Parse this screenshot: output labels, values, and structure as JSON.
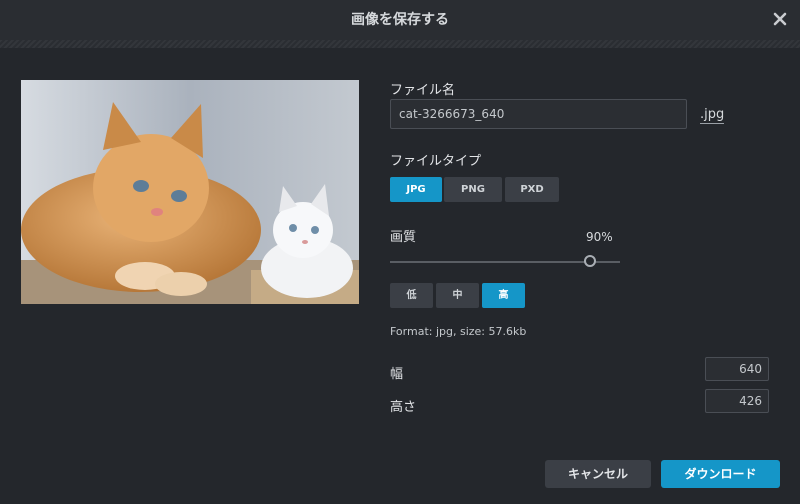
{
  "dialog": {
    "title": "画像を保存する",
    "close_icon": "close-icon"
  },
  "filename": {
    "label": "ファイル名",
    "value": "cat-3266673_640",
    "extension": ".jpg"
  },
  "filetype": {
    "label": "ファイルタイプ",
    "options": [
      "JPG",
      "PNG",
      "PXD"
    ],
    "selected": "JPG"
  },
  "quality": {
    "label": "画質",
    "percent_text": "90%",
    "level": 0.9,
    "presets": [
      "低",
      "中",
      "高"
    ],
    "selected": "高"
  },
  "format_info": "Format: jpg, size: 57.6kb",
  "dimensions": {
    "width_label": "幅",
    "width_value": "640",
    "height_label": "高さ",
    "height_value": "426"
  },
  "buttons": {
    "cancel": "キャンセル",
    "download": "ダウンロード"
  },
  "colors": {
    "background": "#24272c",
    "accent": "#1596c8",
    "secondary_button": "#3b3f46"
  }
}
